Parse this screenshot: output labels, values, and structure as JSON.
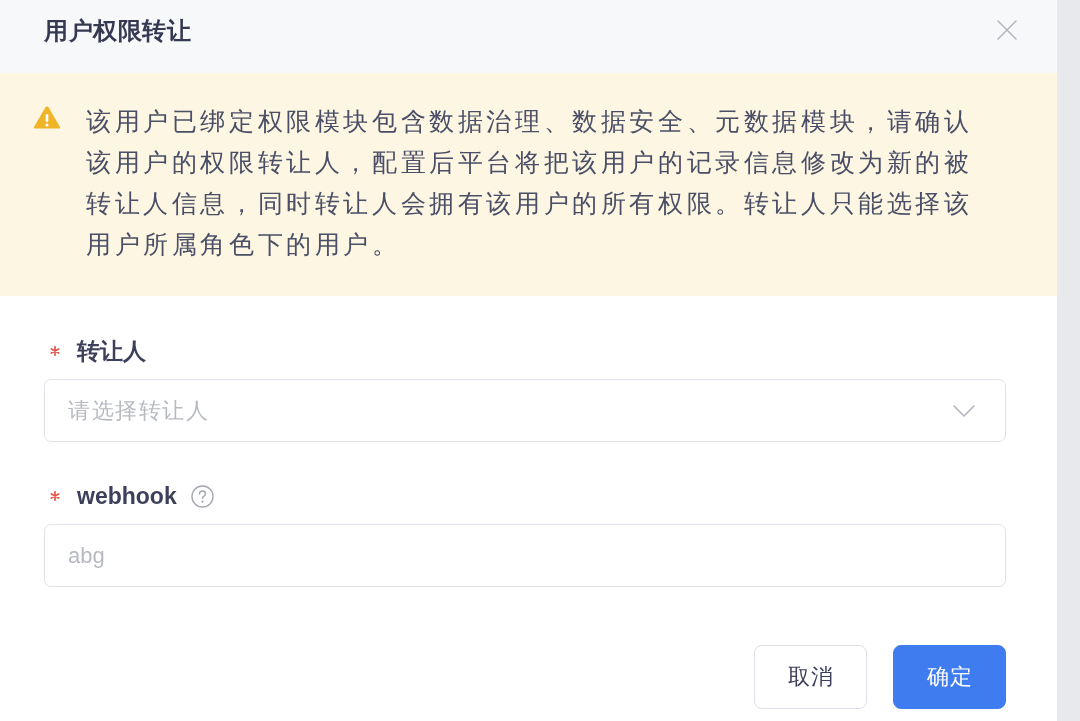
{
  "dialog": {
    "title": "用户权限转让"
  },
  "alert": {
    "kind": "warning",
    "message": "该用户已绑定权限模块包含数据治理、数据安全、元数据模块，请确认该用户的权限转让人，配置后平台将把该用户的记录信息修改为新的被转让人信息，同时转让人会拥有该用户的所有权限。转让人只能选择该用户所属角色下的用户。"
  },
  "form": {
    "fields": [
      {
        "kind": "select",
        "label": "转让人",
        "required": true,
        "placeholder": "请选择转让人"
      },
      {
        "kind": "text",
        "label": "webhook",
        "required": true,
        "help": true,
        "placeholder": "abg"
      }
    ]
  },
  "buttons": [
    {
      "kind": "default",
      "label": "取消"
    },
    {
      "kind": "primary",
      "label": "确定"
    }
  ]
}
